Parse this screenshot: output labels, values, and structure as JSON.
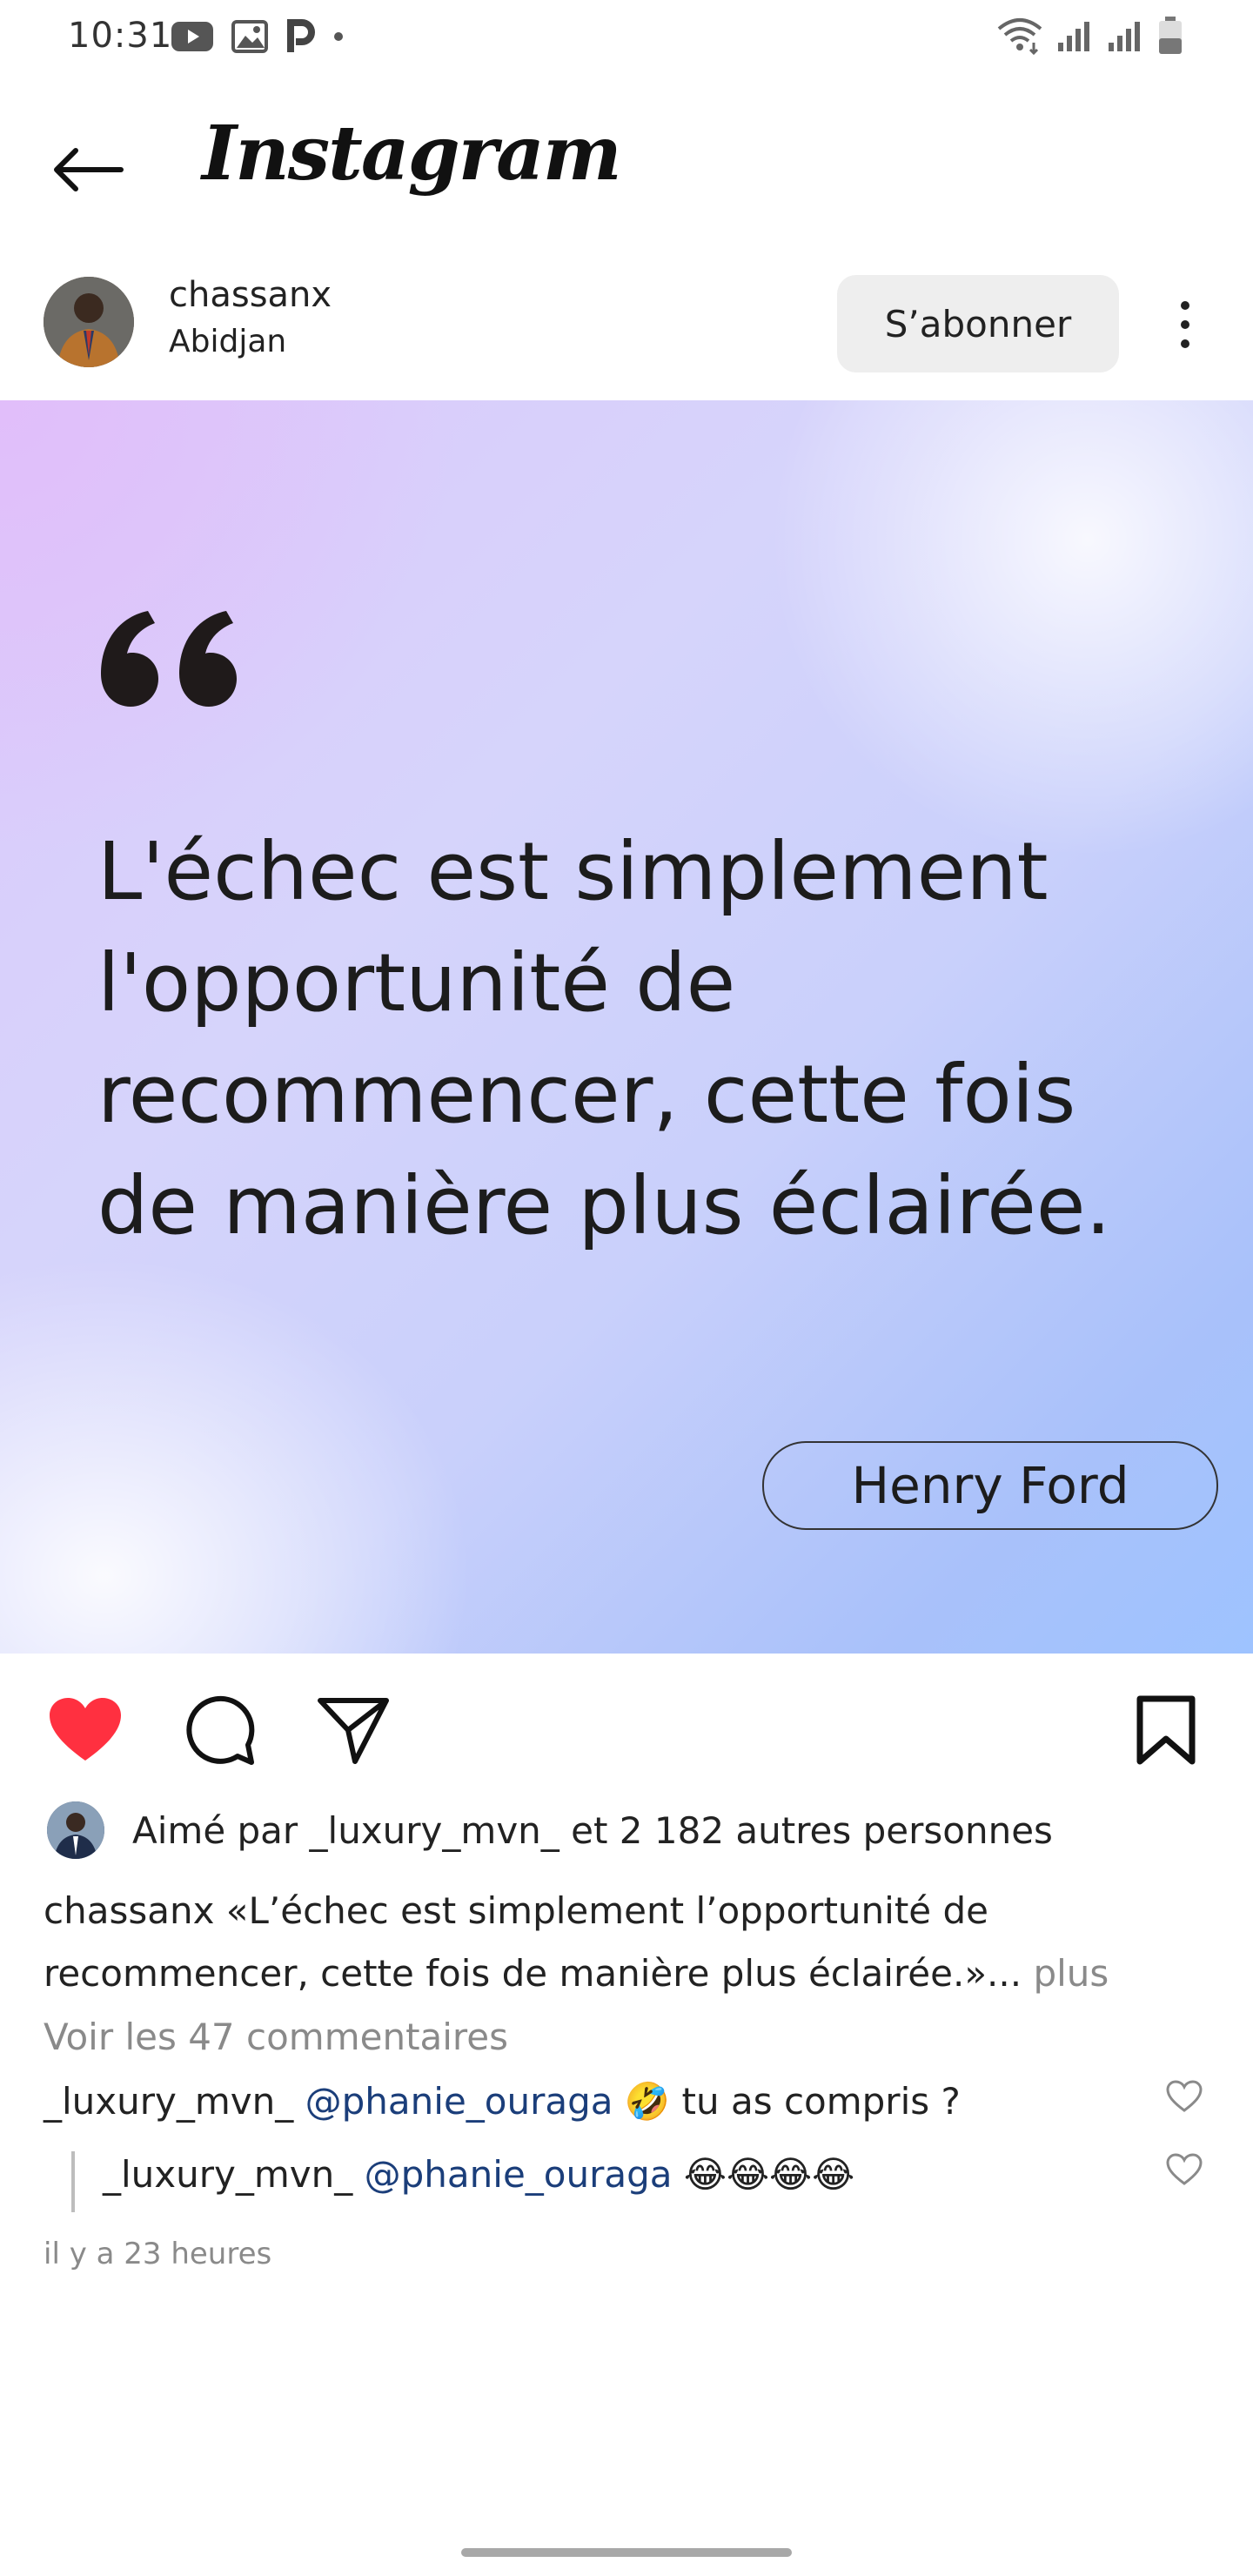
{
  "status_bar": {
    "time": "10:31",
    "left_icons": [
      "youtube-icon",
      "gallery-icon",
      "p-app-icon",
      "dot-icon"
    ],
    "right_icons": [
      "wifi-icon",
      "signal-icon",
      "signal-icon",
      "battery-icon"
    ]
  },
  "header": {
    "app_title": "Instagram"
  },
  "post": {
    "username": "chassanx",
    "location": "Abidjan",
    "follow_label": "S’abonner",
    "quote": "L'échec est simplement l'opportunité de recommencer, cette fois de manière plus éclairée.",
    "author": "Henry Ford",
    "liked_by": "Aimé par _luxury_mvn_ et 2 182 autres personnes",
    "caption_user": "chassanx",
    "caption_text": "«L’échec est simplement l’opportunité de recommencer, cette fois de manière plus éclairée.»...",
    "caption_more": "plus",
    "view_comments": "Voir les 47 commentaires",
    "comments": [
      {
        "user": "_luxury_mvn_",
        "mention": "@phanie_ouraga",
        "emoji": "🤣",
        "text": "tu as compris ?"
      },
      {
        "user": "_luxury_mvn_",
        "mention": "@phanie_ouraga",
        "emoji": "😂😂😂😂",
        "text": ""
      }
    ],
    "timestamp": "il y a 23 heures"
  },
  "colors": {
    "like_red": "#ff3040",
    "mention_blue": "#1b3e7a",
    "gradient_start": "#dcc8fb",
    "gradient_end": "#9ec3ff"
  }
}
